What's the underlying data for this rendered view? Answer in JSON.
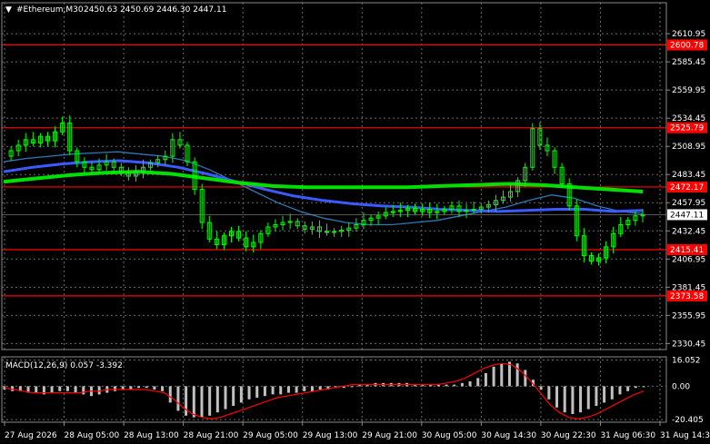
{
  "header": {
    "symbol": "#Ethereum,M30",
    "ohlc": "2450.63 2450.69 2446.30 2447.11"
  },
  "macd_header": "MACD(12,26,9) 0.057 -3.392",
  "colors": {
    "background": "#000000",
    "grid": "#6b6b6b",
    "candle": "#00ff00",
    "level_line": "#ff0000",
    "level_label_bg": "#ff0000",
    "ma_fast": "#2a7ab5",
    "ma_mid": "#3a5cff",
    "ma_slow": "#00e000",
    "macd_hist": "#c0c0c0",
    "macd_signal": "#ff0000",
    "price_label_bg": "#ffffff"
  },
  "chart_data": [
    {
      "type": "candlestick",
      "title": "#Ethereum,M30",
      "y_ticks": [
        "2610.95",
        "2585.45",
        "2559.95",
        "2534.45",
        "2508.95",
        "2483.45",
        "2457.95",
        "2432.45",
        "2406.95",
        "2381.45",
        "2355.95",
        "2330.45"
      ],
      "ylim": [
        2325,
        2625
      ],
      "x_ticks": [
        "27 Aug 2026",
        "28 Aug 05:00",
        "28 Aug 13:00",
        "28 Aug 21:00",
        "29 Aug 05:00",
        "29 Aug 13:00",
        "29 Aug 21:00",
        "30 Aug 05:00",
        "30 Aug 14:30",
        "30 Aug 22:30",
        "31 Aug 06:30",
        "31 Aug 14:30"
      ],
      "levels": [
        {
          "value": 2600.78,
          "label": "2600.78"
        },
        {
          "value": 2525.79,
          "label": "2525.79"
        },
        {
          "value": 2472.17,
          "label": "2472.17"
        },
        {
          "value": 2415.41,
          "label": "2415.41"
        },
        {
          "value": 2373.58,
          "label": "2373.58"
        }
      ],
      "current_price": {
        "value": 2447.11,
        "label": "2447.11"
      },
      "series": [
        {
          "kind": "price",
          "values": [
            2500,
            2505,
            2510,
            2515,
            2512,
            2518,
            2514,
            2522,
            2530,
            2505,
            2495,
            2490,
            2488,
            2492,
            2495,
            2490,
            2485,
            2482,
            2486,
            2490,
            2494,
            2497,
            2500,
            2515,
            2510,
            2495,
            2470,
            2440,
            2425,
            2420,
            2428,
            2432,
            2426,
            2418,
            2422,
            2430,
            2436,
            2438,
            2440,
            2441,
            2437,
            2434,
            2436,
            2432,
            2431,
            2432,
            2433,
            2435,
            2438,
            2442,
            2444,
            2446,
            2449,
            2450,
            2451,
            2453,
            2450,
            2452,
            2449,
            2450,
            2452,
            2455,
            2450,
            2451,
            2452,
            2454,
            2456,
            2460,
            2463,
            2468,
            2478,
            2490,
            2525,
            2510,
            2505,
            2490,
            2475,
            2455,
            2428,
            2410,
            2405,
            2408,
            2418,
            2430,
            2438,
            2442,
            2446,
            2447
          ]
        },
        {
          "kind": "ma_fast",
          "values": [
            2495,
            2498,
            2500,
            2502,
            2503,
            2504,
            2502,
            2500,
            2496,
            2488,
            2478,
            2468,
            2458,
            2450,
            2444,
            2440,
            2438,
            2438,
            2440,
            2442,
            2446,
            2450,
            2454,
            2460,
            2465,
            2462,
            2455,
            2450,
            2448
          ]
        },
        {
          "kind": "ma_mid",
          "values": [
            2486,
            2490,
            2493,
            2495,
            2496,
            2494,
            2490,
            2484,
            2477,
            2470,
            2464,
            2460,
            2457,
            2455,
            2454,
            2452,
            2451,
            2450,
            2451,
            2452,
            2452,
            2450,
            2451
          ]
        },
        {
          "kind": "ma_slow",
          "values": [
            2477,
            2480,
            2483,
            2485,
            2486,
            2484,
            2480,
            2476,
            2473,
            2472,
            2472,
            2472,
            2472,
            2473,
            2474,
            2475,
            2474,
            2472,
            2470,
            2468
          ]
        }
      ]
    },
    {
      "type": "macd",
      "title": "MACD(12,26,9) 0.057 -3.392",
      "y_ticks": [
        "16.052",
        "0.00",
        "-20.405"
      ],
      "ylim": [
        -22,
        18
      ],
      "histogram": [
        -2,
        -3,
        -3,
        -4,
        -4,
        -5,
        -4,
        -3,
        -3,
        -4,
        -5,
        -6,
        -5,
        -4,
        -3,
        -2,
        -2,
        -1,
        -1,
        -2,
        -3,
        -10,
        -15,
        -18,
        -19,
        -19,
        -18,
        -16,
        -14,
        -12,
        -10,
        -8,
        -7,
        -6,
        -5,
        -5,
        -4,
        -4,
        -3,
        -3,
        -2,
        -2,
        -1,
        -1,
        0,
        1,
        1,
        2,
        2,
        2,
        2,
        2,
        1,
        1,
        1,
        1,
        1,
        1,
        2,
        3,
        5,
        8,
        12,
        14,
        15,
        14,
        10,
        4,
        -2,
        -8,
        -13,
        -16,
        -17,
        -16,
        -14,
        -12,
        -10,
        -8,
        -5,
        -3,
        -1,
        0
      ],
      "signal": [
        -1,
        -2,
        -3,
        -4,
        -4,
        -4,
        -4,
        -4,
        -4,
        -3,
        -3,
        -2,
        -2,
        -2,
        -2,
        -2,
        -3,
        -4,
        -8,
        -13,
        -17,
        -19,
        -20,
        -19,
        -17,
        -15,
        -13,
        -11,
        -9,
        -7,
        -6,
        -5,
        -4,
        -3,
        -2,
        -1,
        0,
        1,
        1,
        1,
        1,
        1,
        1,
        1,
        1,
        1,
        1,
        2,
        3,
        5,
        8,
        11,
        13,
        14,
        13,
        9,
        3,
        -4,
        -11,
        -16,
        -19,
        -20,
        -19,
        -17,
        -14,
        -11,
        -8,
        -5,
        -3
      ]
    }
  ]
}
